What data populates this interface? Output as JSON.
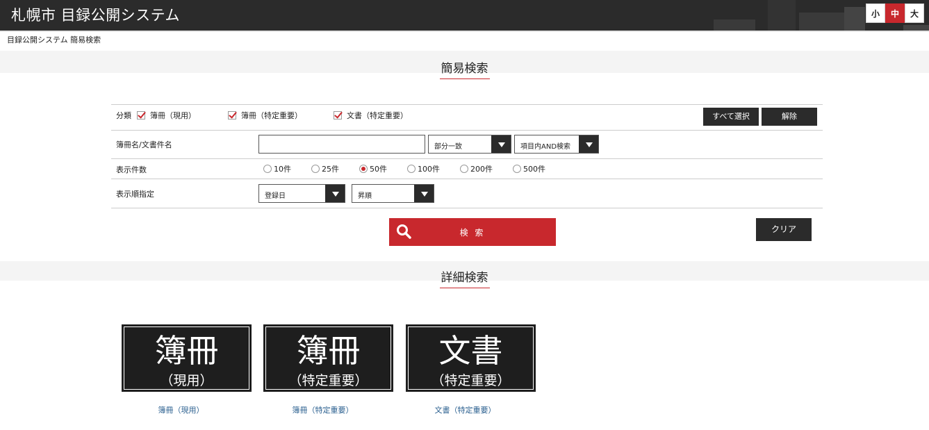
{
  "header": {
    "title": "札幌市 目録公開システム",
    "font_sizes": [
      "小",
      "中",
      "大"
    ],
    "active_font_size": "中"
  },
  "breadcrumb": "目録公開システム 簡易検索",
  "simple_search": {
    "title": "簡易検索",
    "category_label": "分類",
    "categories": [
      {
        "label": "簿冊（現用）",
        "checked": true
      },
      {
        "label": "簿冊（特定重要）",
        "checked": true
      },
      {
        "label": "文書（特定重要）",
        "checked": true
      }
    ],
    "select_all_label": "すべて選択",
    "clear_selection_label": "解除",
    "name_label": "簿冊名/文書件名",
    "name_value": "",
    "match_mode": "部分一致",
    "search_mode": "項目内AND検索",
    "count_label": "表示件数",
    "count_options": [
      "10件",
      "25件",
      "50件",
      "100件",
      "200件",
      "500件"
    ],
    "count_selected": "50件",
    "order_label": "表示順指定",
    "order_field": "登録日",
    "order_direction": "昇順",
    "search_button": "検 索",
    "clear_button": "クリア"
  },
  "detail_search": {
    "title": "詳細検索",
    "tiles": [
      {
        "big": "簿冊",
        "small": "（現用）",
        "link": "簿冊（現用）"
      },
      {
        "big": "簿冊",
        "small": "（特定重要）",
        "link": "簿冊（特定重要）"
      },
      {
        "big": "文書",
        "small": "（特定重要）",
        "link": "文書（特定重要）"
      }
    ]
  },
  "colors": {
    "accent": "#c8282d",
    "dark": "#2b2b2b",
    "link": "#2a5f8f"
  }
}
